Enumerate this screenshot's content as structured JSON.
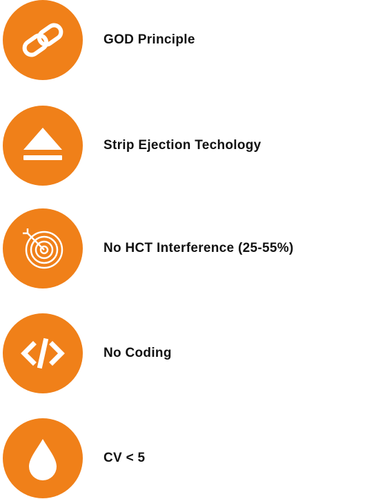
{
  "colors": {
    "accent": "#f08019",
    "icon_fg": "#ffffff",
    "text": "#111111"
  },
  "features": [
    {
      "icon": "link-icon",
      "label": "GOD Principle"
    },
    {
      "icon": "eject-icon",
      "label": "Strip Ejection Techology"
    },
    {
      "icon": "target-icon",
      "label": "No HCT Interference (25-55%)"
    },
    {
      "icon": "code-icon",
      "label": "No Coding"
    },
    {
      "icon": "drop-icon",
      "label": "CV < 5"
    }
  ]
}
